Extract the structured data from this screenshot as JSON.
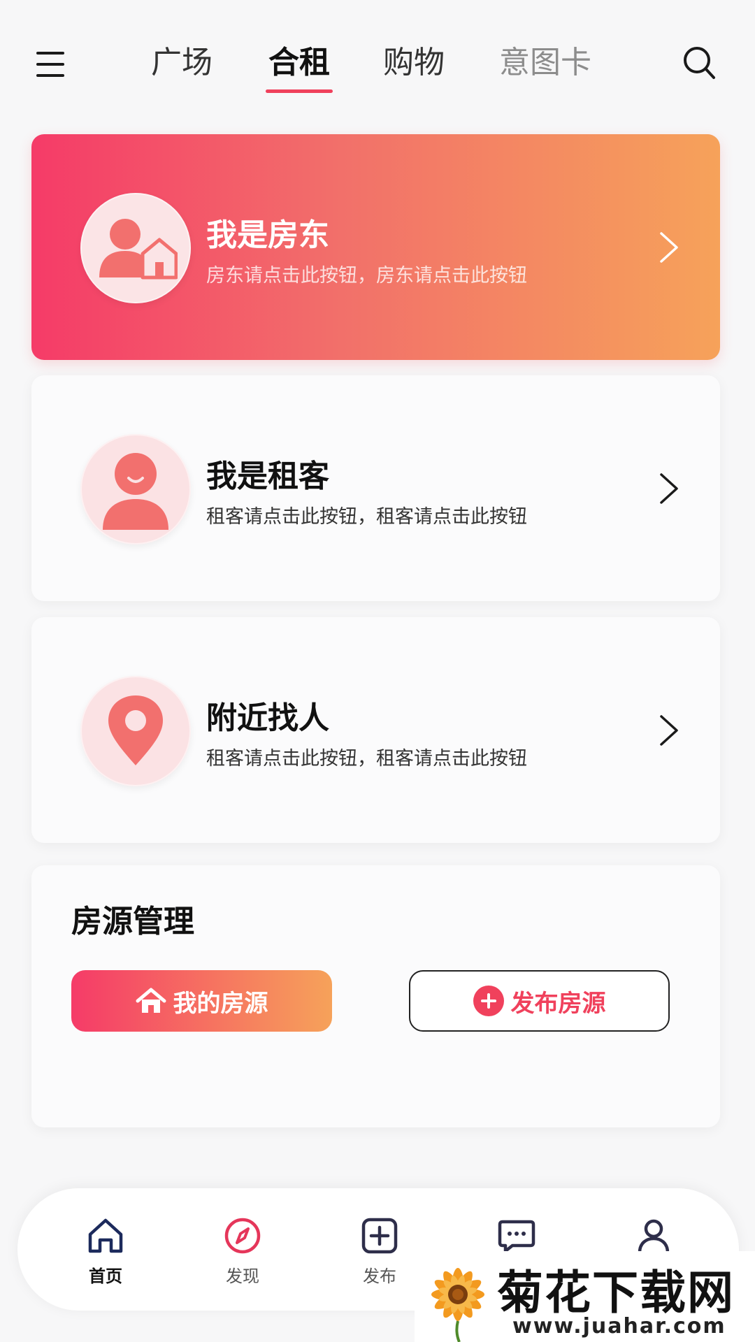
{
  "header": {
    "tabs": [
      {
        "label": "广场"
      },
      {
        "label": "合租"
      },
      {
        "label": "购物"
      },
      {
        "label": "意图卡"
      }
    ],
    "active_tab": "合租"
  },
  "cards": {
    "landlord": {
      "title": "我是房东",
      "subtitle": "房东请点击此按钮，房东请点击此按钮"
    },
    "tenant": {
      "title": "我是租客",
      "subtitle": "租客请点击此按钮，租客请点击此按钮"
    },
    "nearby": {
      "title": "附近找人",
      "subtitle": "租客请点击此按钮，租客请点击此按钮"
    }
  },
  "manage": {
    "title": "房源管理",
    "my_listings_label": "我的房源",
    "publish_label": "发布房源"
  },
  "bottom_nav": [
    {
      "label": "首页",
      "icon": "home-icon",
      "active": true
    },
    {
      "label": "发现",
      "icon": "compass-icon"
    },
    {
      "label": "发布",
      "icon": "plus-square-icon"
    },
    {
      "label": "",
      "icon": "chat-icon"
    },
    {
      "label": "",
      "icon": "user-icon"
    }
  ],
  "watermark": {
    "brand": "菊花下载网",
    "url": "www.juahar.com"
  },
  "colors": {
    "accent": "#f0415c",
    "gradient_start": "#f53b68",
    "gradient_end": "#f6a25a",
    "icon_pink": "#f2706e"
  }
}
